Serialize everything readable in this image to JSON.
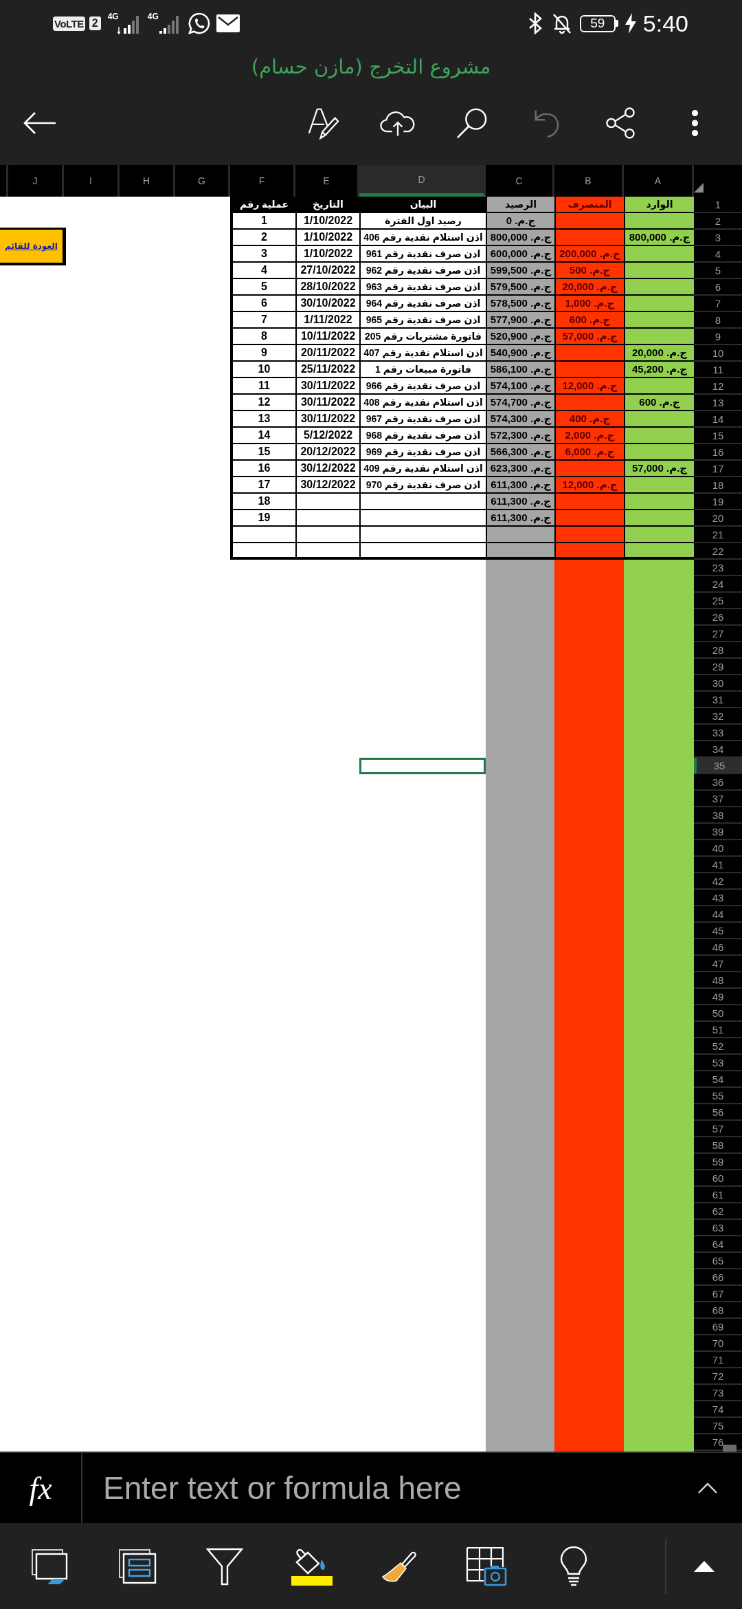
{
  "status_bar": {
    "volte": "VoLTE",
    "sim": "2",
    "network_sim1": "4G",
    "network_sim2": "4G",
    "battery": "59",
    "time": "5:40"
  },
  "title": "مشروع التخرج (مازن حسام)",
  "toolbar": [
    {
      "kind": "back",
      "disabled": false
    },
    {
      "kind": "draw",
      "disabled": false
    },
    {
      "kind": "upload",
      "disabled": false
    },
    {
      "kind": "search",
      "disabled": false
    },
    {
      "kind": "undo",
      "disabled": true
    },
    {
      "kind": "share",
      "disabled": false
    },
    {
      "kind": "more",
      "disabled": false
    }
  ],
  "sheet": {
    "column_headers": [
      {
        "label": "A",
        "selected": false
      },
      {
        "label": "B",
        "selected": false
      },
      {
        "label": "C",
        "selected": false
      },
      {
        "label": "D",
        "selected": true
      },
      {
        "label": "E",
        "selected": false
      },
      {
        "label": "F",
        "selected": false
      },
      {
        "label": "G",
        "selected": false
      },
      {
        "label": "H",
        "selected": false
      },
      {
        "label": "I",
        "selected": false
      },
      {
        "label": "J",
        "selected": false
      }
    ],
    "row_headers": [
      {
        "label": "1",
        "selected": false
      },
      {
        "label": "2",
        "selected": false
      },
      {
        "label": "3",
        "selected": false
      },
      {
        "label": "4",
        "selected": false
      },
      {
        "label": "5",
        "selected": false
      },
      {
        "label": "6",
        "selected": false
      },
      {
        "label": "7",
        "selected": false
      },
      {
        "label": "8",
        "selected": false
      },
      {
        "label": "9",
        "selected": false
      },
      {
        "label": "10",
        "selected": false
      },
      {
        "label": "11",
        "selected": false
      },
      {
        "label": "12",
        "selected": false
      },
      {
        "label": "13",
        "selected": false
      },
      {
        "label": "14",
        "selected": false
      },
      {
        "label": "15",
        "selected": false
      },
      {
        "label": "16",
        "selected": false
      },
      {
        "label": "17",
        "selected": false
      },
      {
        "label": "18",
        "selected": false
      },
      {
        "label": "19",
        "selected": false
      },
      {
        "label": "20",
        "selected": false
      },
      {
        "label": "21",
        "selected": false
      },
      {
        "label": "22",
        "selected": false
      },
      {
        "label": "23",
        "selected": false
      },
      {
        "label": "24",
        "selected": false
      },
      {
        "label": "25",
        "selected": false
      },
      {
        "label": "26",
        "selected": false
      },
      {
        "label": "27",
        "selected": false
      },
      {
        "label": "28",
        "selected": false
      },
      {
        "label": "29",
        "selected": false
      },
      {
        "label": "30",
        "selected": false
      },
      {
        "label": "31",
        "selected": false
      },
      {
        "label": "32",
        "selected": false
      },
      {
        "label": "33",
        "selected": false
      },
      {
        "label": "34",
        "selected": false
      },
      {
        "label": "35",
        "selected": true
      },
      {
        "label": "36",
        "selected": false
      },
      {
        "label": "37",
        "selected": false
      },
      {
        "label": "38",
        "selected": false
      },
      {
        "label": "39",
        "selected": false
      },
      {
        "label": "40",
        "selected": false
      },
      {
        "label": "41",
        "selected": false
      },
      {
        "label": "42",
        "selected": false
      },
      {
        "label": "43",
        "selected": false
      },
      {
        "label": "44",
        "selected": false
      },
      {
        "label": "45",
        "selected": false
      },
      {
        "label": "46",
        "selected": false
      },
      {
        "label": "47",
        "selected": false
      },
      {
        "label": "48",
        "selected": false
      },
      {
        "label": "49",
        "selected": false
      },
      {
        "label": "50",
        "selected": false
      },
      {
        "label": "51",
        "selected": false
      },
      {
        "label": "52",
        "selected": false
      },
      {
        "label": "53",
        "selected": false
      },
      {
        "label": "54",
        "selected": false
      },
      {
        "label": "55",
        "selected": false
      },
      {
        "label": "56",
        "selected": false
      },
      {
        "label": "57",
        "selected": false
      },
      {
        "label": "58",
        "selected": false
      },
      {
        "label": "59",
        "selected": false
      },
      {
        "label": "60",
        "selected": false
      },
      {
        "label": "61",
        "selected": false
      },
      {
        "label": "62",
        "selected": false
      },
      {
        "label": "63",
        "selected": false
      },
      {
        "label": "64",
        "selected": false
      },
      {
        "label": "65",
        "selected": false
      },
      {
        "label": "66",
        "selected": false
      },
      {
        "label": "67",
        "selected": false
      },
      {
        "label": "68",
        "selected": false
      },
      {
        "label": "69",
        "selected": false
      },
      {
        "label": "70",
        "selected": false
      },
      {
        "label": "71",
        "selected": false
      },
      {
        "label": "72",
        "selected": false
      },
      {
        "label": "73",
        "selected": false
      },
      {
        "label": "74",
        "selected": false
      },
      {
        "label": "75",
        "selected": false
      },
      {
        "label": "76",
        "selected": false
      }
    ],
    "table": {
      "columns": [
        {
          "heading": "الوارد",
          "kind": "colored",
          "color": "#92d050"
        },
        {
          "heading": "المنصرف",
          "kind": "colored",
          "color": "#ff3300"
        },
        {
          "heading": "الرصيد",
          "kind": "colored",
          "color": "#a6a6a6"
        },
        {
          "heading": "البيان",
          "kind": "plain"
        },
        {
          "heading": "التاريخ",
          "kind": "plain"
        },
        {
          "heading": "عملية رقم",
          "kind": "plain"
        }
      ],
      "rows": [
        {
          "balance": "ج.م. 0",
          "description": "رصيد اول الفترة",
          "date": "1/10/2022",
          "number": "1"
        },
        {
          "incoming": "ج.م. 800,000",
          "balance": "ج.م. 800,000",
          "description": "اذن استلام نقدية رقم 406",
          "date": "1/10/2022",
          "number": "2"
        },
        {
          "outgoing": "ج.م. 200,000",
          "balance": "ج.م. 600,000",
          "description": "اذن صرف نقدية رقم 961",
          "date": "1/10/2022",
          "number": "3"
        },
        {
          "outgoing": "ج.م. 500",
          "balance": "ج.م. 599,500",
          "description": "اذن صرف نقدية رقم 962",
          "date": "27/10/2022",
          "number": "4"
        },
        {
          "outgoing": "ج.م. 20,000",
          "balance": "ج.م. 579,500",
          "description": "اذن صرف نقدية رقم 963",
          "date": "28/10/2022",
          "number": "5"
        },
        {
          "outgoing": "ج.م. 1,000",
          "balance": "ج.م. 578,500",
          "description": "اذن صرف نقدية رقم 964",
          "date": "30/10/2022",
          "number": "6"
        },
        {
          "outgoing": "ج.م. 600",
          "balance": "ج.م. 577,900",
          "description": "اذن صرف نقدية رقم 965",
          "date": "1/11/2022",
          "number": "7"
        },
        {
          "outgoing": "ج.م. 57,000",
          "balance": "ج.م. 520,900",
          "description": "فاتورة مشتريات رقم 205",
          "date": "10/11/2022",
          "number": "8"
        },
        {
          "incoming": "ج.م. 20,000",
          "balance": "ج.م. 540,900",
          "description": "اذن استلام نقدية رقم 407",
          "date": "20/11/2022",
          "number": "9"
        },
        {
          "incoming": "ج.م. 45,200",
          "balance": "ج.م. 586,100",
          "description": "فاتورة مبيعات رقم 1",
          "date": "25/11/2022",
          "number": "10"
        },
        {
          "outgoing": "ج.م. 12,000",
          "balance": "ج.م. 574,100",
          "description": "اذن صرف نقدية رقم 966",
          "date": "30/11/2022",
          "number": "11"
        },
        {
          "incoming": "ج.م. 600",
          "balance": "ج.م. 574,700",
          "description": "اذن استلام نقدية رقم 408",
          "date": "30/11/2022",
          "number": "12"
        },
        {
          "outgoing": "ج.م. 400",
          "balance": "ج.م. 574,300",
          "description": "اذن صرف نقدية رقم 967",
          "date": "30/11/2022",
          "number": "13"
        },
        {
          "outgoing": "ج.م. 2,000",
          "balance": "ج.م. 572,300",
          "description": "اذن صرف نقدية رقم 968",
          "date": "5/12/2022",
          "number": "14"
        },
        {
          "outgoing": "ج.م. 6,000",
          "balance": "ج.م. 566,300",
          "description": "اذن صرف نقدية رقم 969",
          "date": "20/12/2022",
          "number": "15"
        },
        {
          "incoming": "ج.م. 57,000",
          "balance": "ج.م. 623,300",
          "description": "اذن استلام نقدية رقم 409",
          "date": "30/12/2022",
          "number": "16"
        },
        {
          "outgoing": "ج.م. 12,000",
          "balance": "ج.م. 611,300",
          "description": "اذن صرف نقدية رقم 970",
          "date": "30/12/2022",
          "number": "17"
        },
        {
          "balance": "ج.م. 611,300",
          "number": "18"
        },
        {
          "balance": "ج.م. 611,300",
          "number": "19"
        },
        {},
        {}
      ]
    },
    "link_button": {
      "text": "العودة للقائم"
    }
  },
  "formula_bar": {
    "function_label": "fx",
    "placeholder": "Enter text or formula here"
  }
}
